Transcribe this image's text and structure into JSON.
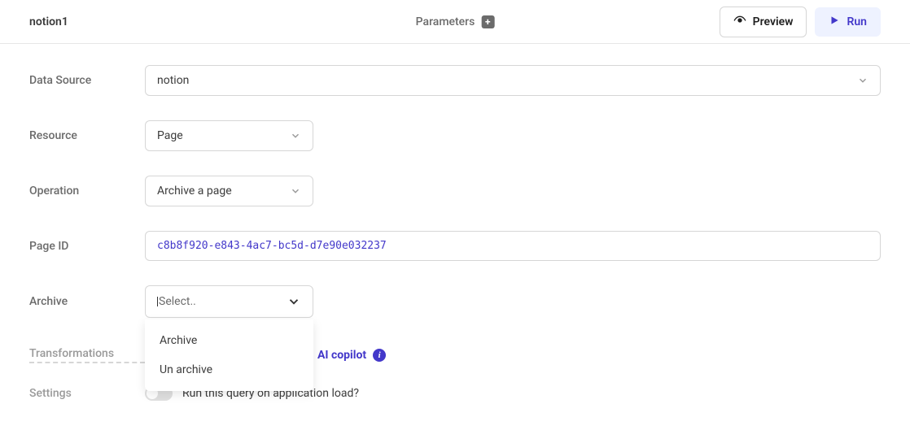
{
  "header": {
    "title": "notion1",
    "center_label": "Parameters",
    "preview_label": "Preview",
    "run_label": "Run"
  },
  "fields": {
    "data_source": {
      "label": "Data Source",
      "value": "notion"
    },
    "resource": {
      "label": "Resource",
      "value": "Page"
    },
    "operation": {
      "label": "Operation",
      "value": "Archive a page"
    },
    "page_id": {
      "label": "Page ID",
      "value": "c8b8f920-e843-4ac7-bc5d-d7e90e032237"
    },
    "archive": {
      "label": "Archive",
      "placeholder": "Select..",
      "options": [
        "Archive",
        "Un archive"
      ]
    }
  },
  "sections": {
    "transformations_label": "Transformations",
    "ai_copilot_label": "AI copilot",
    "settings_label": "Settings",
    "run_on_load_label": "Run this query on application load?"
  }
}
